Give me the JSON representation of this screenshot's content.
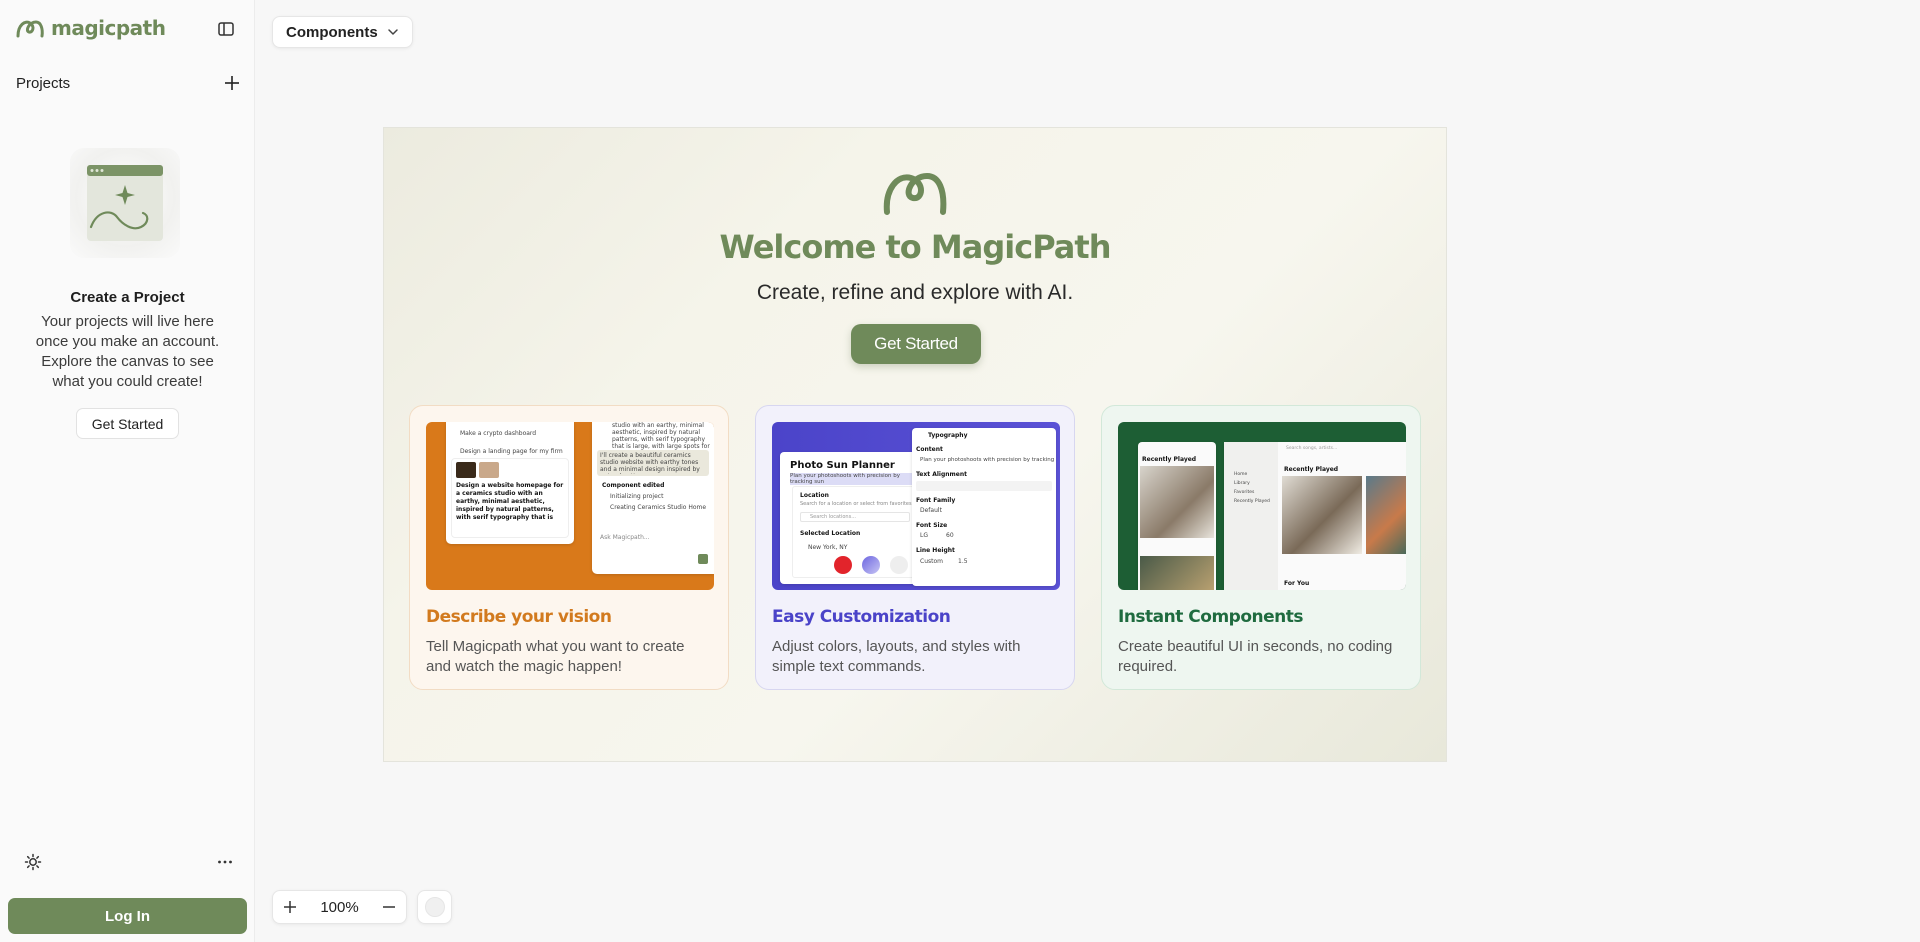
{
  "sidebar": {
    "brand": "magicpath",
    "projects_label": "Projects",
    "empty_title": "Create a Project",
    "empty_desc": "Your projects will live here once you make an account. Explore the canvas to see what you could create!",
    "empty_button": "Get Started",
    "login_button": "Log In"
  },
  "toolbar": {
    "components_label": "Components"
  },
  "hero": {
    "title": "Welcome to MagicPath",
    "subtitle": "Create, refine and explore with AI.",
    "button": "Get Started"
  },
  "features": [
    {
      "title": "Describe your vision",
      "desc": "Tell Magicpath what you want to create and watch the magic happen!",
      "mock": {
        "l1": "Make a crypto dashboard",
        "l2": "Design a landing page for my firm",
        "l3": "Design a website homepage for a ceramics studio with an earthy, minimal aesthetic, inspired by natural patterns, with serif typography that is large, with large spots for photography.",
        "r1": "studio with an earthy, minimal aesthetic, inspired by natural patterns, with serif typography that is large, with large spots for photography.",
        "r2": "I'll create a beautiful ceramics studio website with earthy tones and a minimal design inspired by natural patterns.",
        "r3": "Component edited",
        "r4": "Initializing project",
        "r5": "Creating Ceramics Studio Home",
        "r6": "Ask Magicpath..."
      }
    },
    {
      "title": "Easy Customization",
      "desc": "Adjust colors, layouts, and styles with simple text commands.",
      "mock": {
        "card_title": "Photo Sun Planner",
        "card_sub": "Plan your photoshoots with precision by tracking sun",
        "location": "Location",
        "location_hint": "Search for a location or select from favorites",
        "search": "Search locations...",
        "selected": "Selected Location",
        "city": "New York, NY",
        "panel_title": "Typography",
        "content_label": "Content",
        "content_value": "Plan your photoshoots with precision by tracking sun",
        "align_label": "Text Alignment",
        "family_label": "Font Family",
        "family_value": "Default",
        "size_label": "Font Size",
        "size_unit": "LG",
        "size_value": "60",
        "lh_label": "Line Height",
        "lh_mode": "Custom",
        "lh_value": "1.5"
      }
    },
    {
      "title": "Instant Components",
      "desc": "Create beautiful UI in seconds, no coding required.",
      "mock": {
        "left_header": "Recently Played",
        "right_header": "Recently Played",
        "nav": [
          "Home",
          "Library",
          "Favorites",
          "Recently Played"
        ],
        "search": "Search songs, artists...",
        "foryou": "For You"
      }
    }
  ],
  "zoom": {
    "value": "100%"
  },
  "colors": {
    "brand": "#6f8a5a",
    "orange": "#d27a1e",
    "violet": "#4a43c8",
    "green": "#1f6b3f"
  }
}
